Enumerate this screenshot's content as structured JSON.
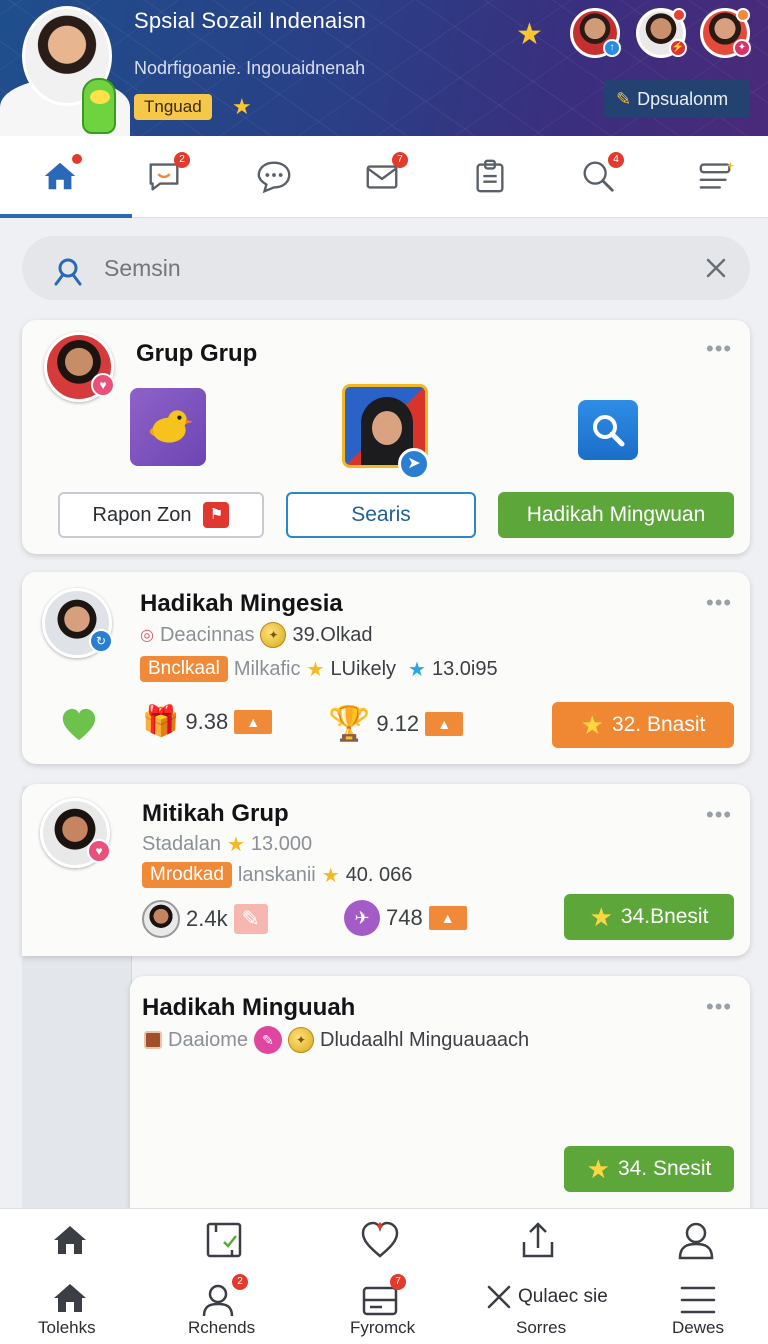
{
  "header": {
    "title": "Spsial Sozail Indenaisn",
    "subtitle": "Nodrfigoanie. Ingouaidnenah",
    "badge": "Tnguad",
    "pill": "Dpsualonm"
  },
  "top_nav": [
    {
      "name": "home",
      "badge": "1"
    },
    {
      "name": "messages",
      "badge": "2"
    },
    {
      "name": "chat",
      "badge": ""
    },
    {
      "name": "inbox",
      "badge": "7"
    },
    {
      "name": "clipboard",
      "badge": ""
    },
    {
      "name": "search",
      "badge": "4"
    },
    {
      "name": "menu",
      "badge": ""
    }
  ],
  "search": {
    "placeholder": "Semsin"
  },
  "card1": {
    "title": "Grup Grup",
    "buttons": {
      "left": "Rapon Zon",
      "middle": "Searis",
      "right": "Hadikah Mingwuan"
    }
  },
  "card2": {
    "title": "Hadikah Mingesia",
    "line1": {
      "label": "Deacinnas",
      "value": "39.Olkad"
    },
    "line2": {
      "tag": "Bnclkaal",
      "muted": "Milkafic",
      "likely": "LUikely",
      "value": "13.0i95"
    },
    "stats": {
      "a": "9.38",
      "b": "9.12"
    },
    "action": "32. Bnasit"
  },
  "card3": {
    "title": "Mitikah Grup",
    "line1": {
      "label": "Stadalan",
      "value": "13.000"
    },
    "line2": {
      "tag": "Mrodkad",
      "muted": "lanskanii",
      "value": "40. 066"
    },
    "stats": {
      "a": "2.4k",
      "b": "748"
    },
    "action": "34.Bnesit"
  },
  "card4": {
    "title": "Hadikah Minguuah",
    "line1": {
      "label": "Daaiome",
      "value": "Dludaalhl Minguauaach"
    },
    "action": "34. Snesit"
  },
  "bottom_nav": {
    "labels": [
      "Tolehks",
      "Rchends",
      "Fyromck",
      "Qulaec sie",
      "Sorres",
      "Dewes"
    ],
    "badges": {
      "rchends": "2",
      "fyromck": "7"
    }
  },
  "colors": {
    "accent_blue": "#2a68b8",
    "orange": "#f08732",
    "green": "#5da73a",
    "notification_red": "#e23a2c"
  }
}
